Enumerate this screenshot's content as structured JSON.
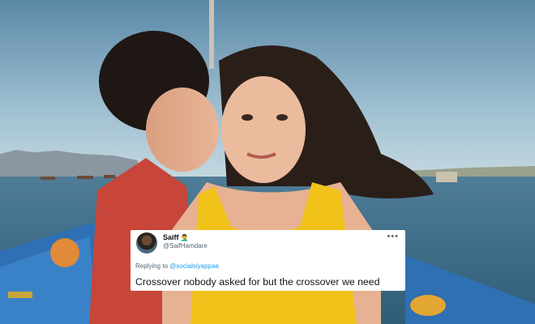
{
  "tweet": {
    "name": "Saiff",
    "name_badge": "🤦‍♂️",
    "handle": "@SaifHamdare",
    "more": "•••",
    "replying_prefix": "Replying to",
    "replying_to": "@socialsiyappaa",
    "text": "Crossover nobody asked for but the crossover we need"
  }
}
